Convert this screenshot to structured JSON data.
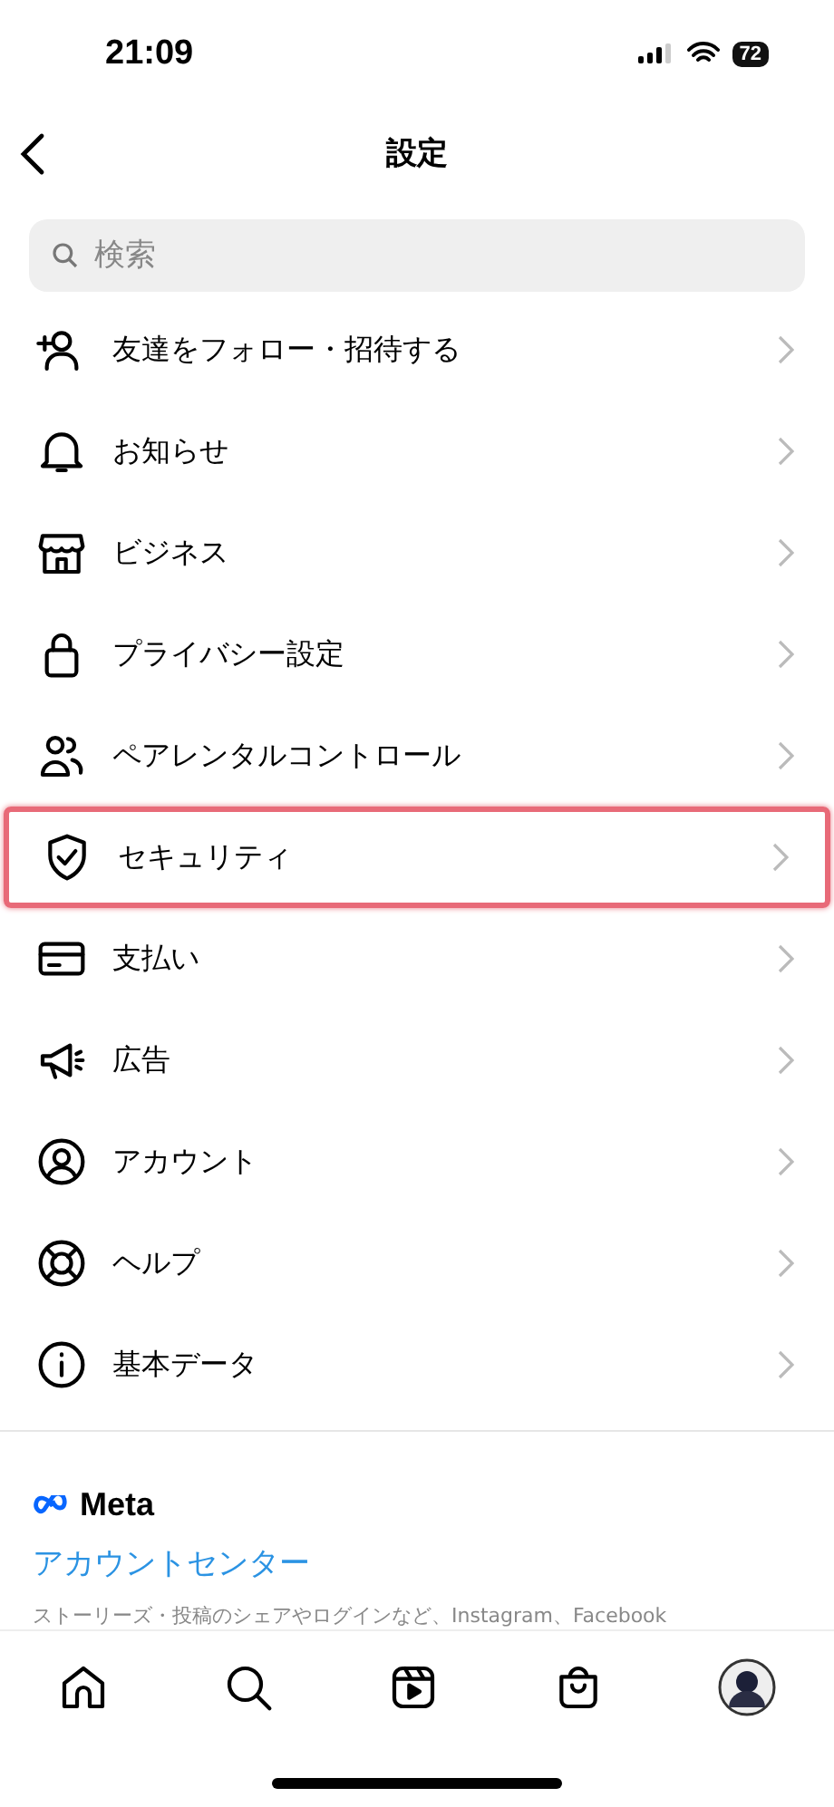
{
  "status_bar": {
    "time": "21:09",
    "battery": "72"
  },
  "header": {
    "title": "設定"
  },
  "search": {
    "placeholder": "検索"
  },
  "items": [
    {
      "label": "友達をフォロー・招待する",
      "highlighted": false
    },
    {
      "label": "お知らせ",
      "highlighted": false
    },
    {
      "label": "ビジネス",
      "highlighted": false
    },
    {
      "label": "プライバシー設定",
      "highlighted": false
    },
    {
      "label": "ペアレンタルコントロール",
      "highlighted": false
    },
    {
      "label": "セキュリティ",
      "highlighted": true
    },
    {
      "label": "支払い",
      "highlighted": false
    },
    {
      "label": "広告",
      "highlighted": false
    },
    {
      "label": "アカウント",
      "highlighted": false
    },
    {
      "label": "ヘルプ",
      "highlighted": false
    },
    {
      "label": "基本データ",
      "highlighted": false
    }
  ],
  "meta": {
    "logo": "Meta",
    "link": "アカウントセンター",
    "description": "ストーリーズ・投稿のシェアやログインなど、Instagram、Facebook"
  },
  "tab_bar": [
    {
      "selected": false
    },
    {
      "selected": false
    },
    {
      "selected": false
    },
    {
      "selected": false
    },
    {
      "selected": false
    }
  ]
}
